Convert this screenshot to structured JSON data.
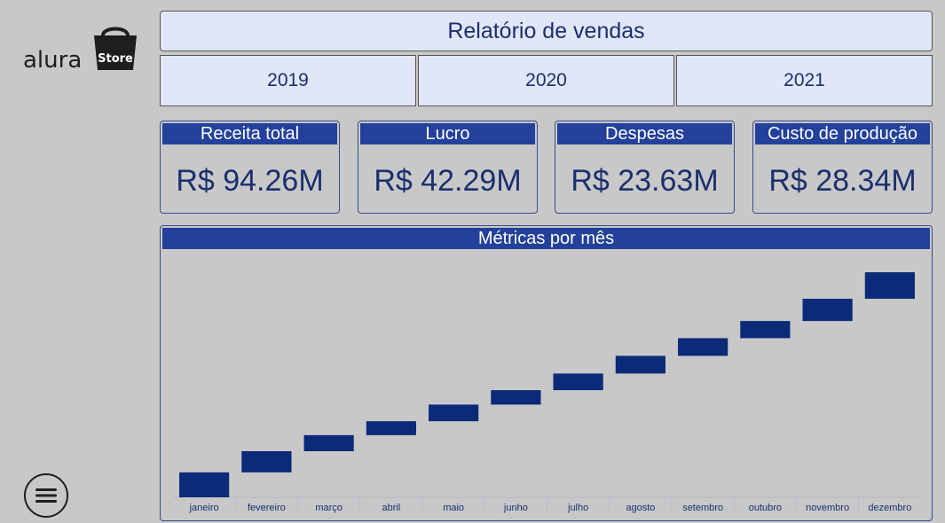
{
  "logo": {
    "text": "alura",
    "badge": "Store"
  },
  "header": {
    "title": "Relatório de vendas"
  },
  "years": [
    "2019",
    "2020",
    "2021"
  ],
  "kpis": [
    {
      "label": "Receita total",
      "value": "R$ 94.26M"
    },
    {
      "label": "Lucro",
      "value": "R$ 42.29M"
    },
    {
      "label": "Despesas",
      "value": "R$ 23.63M"
    },
    {
      "label": "Custo de produção",
      "value": "R$ 28.34M"
    }
  ],
  "menu": {
    "icon": "hamburger-menu-icon"
  },
  "colors": {
    "accent": "#23419a",
    "bar": "#0b2a78",
    "panel_bg": "#e1e6f8",
    "page_bg": "#c8c8c8"
  },
  "chart_data": {
    "type": "waterfall",
    "title": "Métricas por mês",
    "categories": [
      "janeiro",
      "fevereiro",
      "março",
      "abril",
      "maio",
      "junho",
      "julho",
      "agosto",
      "setembro",
      "outubro",
      "novembro",
      "dezembro"
    ],
    "segments": [
      {
        "start": 0.0,
        "end": 9.3
      },
      {
        "start": 9.3,
        "end": 17.2
      },
      {
        "start": 17.2,
        "end": 23.2
      },
      {
        "start": 23.2,
        "end": 28.4
      },
      {
        "start": 28.4,
        "end": 34.6
      },
      {
        "start": 34.6,
        "end": 40.0
      },
      {
        "start": 40.0,
        "end": 46.2
      },
      {
        "start": 46.2,
        "end": 52.8
      },
      {
        "start": 52.8,
        "end": 59.4
      },
      {
        "start": 59.4,
        "end": 65.8
      },
      {
        "start": 65.8,
        "end": 74.1
      },
      {
        "start": 74.1,
        "end": 84.0
      }
    ],
    "ylim": [
      0,
      90
    ],
    "grid": false,
    "legend": false
  }
}
